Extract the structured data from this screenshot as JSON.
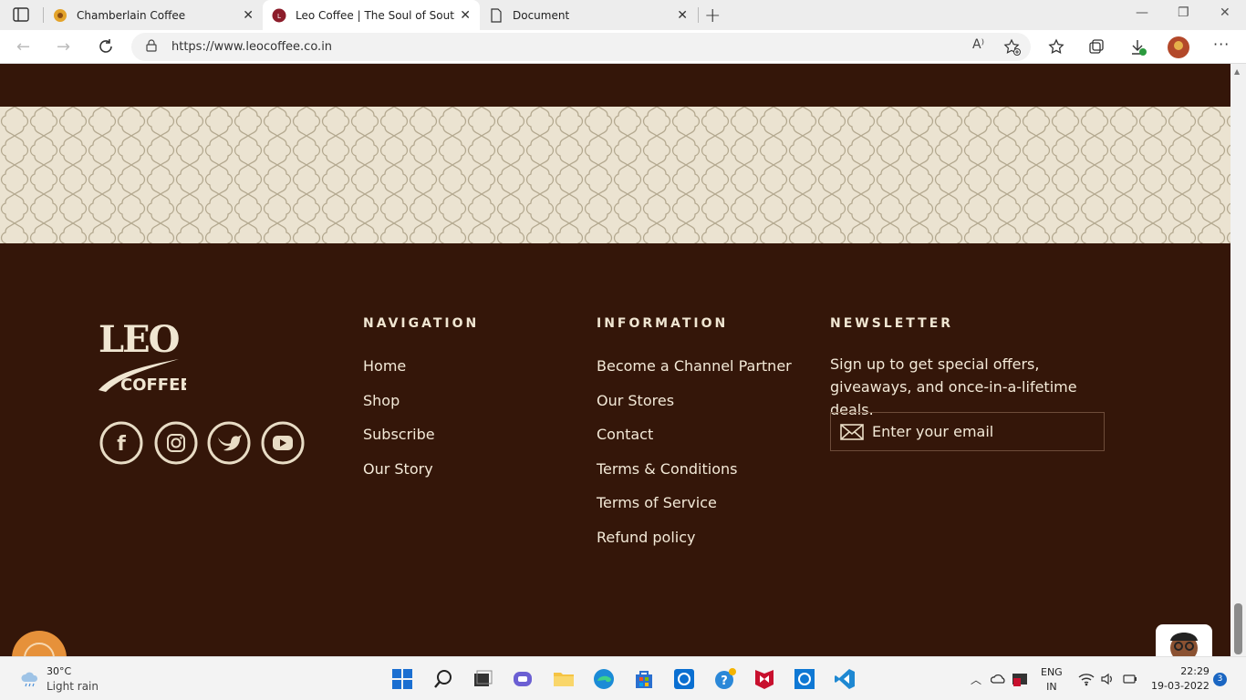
{
  "browser": {
    "tabs": [
      {
        "title": "Chamberlain Coffee",
        "active": false
      },
      {
        "title": "Leo Coffee | The Soul of South In",
        "active": true
      },
      {
        "title": "Document",
        "active": false
      }
    ],
    "url": "https://www.leocoffee.co.in"
  },
  "footer": {
    "logo_text_top": "LEO",
    "logo_text_bottom": "COFFEE",
    "social": [
      "facebook-icon",
      "instagram-icon",
      "twitter-icon",
      "youtube-icon"
    ],
    "navigation": {
      "title": "NAVIGATION",
      "links": [
        "Home",
        "Shop",
        "Subscribe",
        "Our Story"
      ]
    },
    "information": {
      "title": "INFORMATION",
      "links": [
        "Become a Channel Partner",
        "Our Stores",
        "Contact",
        "Terms & Conditions",
        "Terms of Service",
        "Refund policy"
      ]
    },
    "newsletter": {
      "title": "NEWSLETTER",
      "text": "Sign up to get special offers, giveaways, and once-in-a-lifetime deals.",
      "email_placeholder": "Enter your email"
    }
  },
  "colors": {
    "footer_bg": "#341609",
    "pattern_bg": "#ebe3d1",
    "text": "#f3e9d7"
  },
  "taskbar": {
    "weather_temp": "30°C",
    "weather_desc": "Light rain",
    "lang_line1": "ENG",
    "lang_line2": "IN",
    "time": "22:29",
    "date": "19-03-2022",
    "notifications": "3"
  }
}
